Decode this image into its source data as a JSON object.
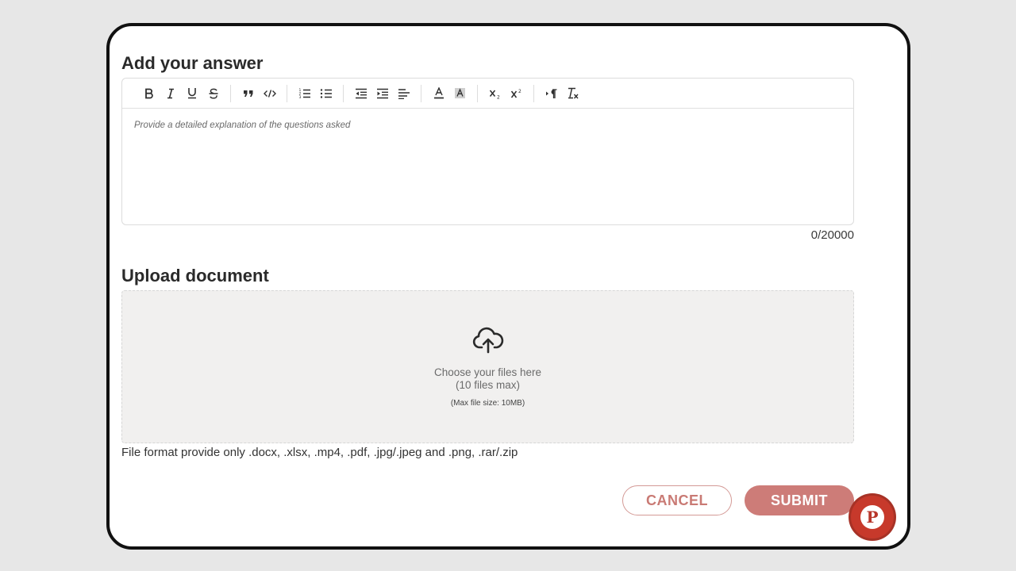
{
  "answer": {
    "title": "Add your answer",
    "placeholder": "Provide a detailed explanation of the questions asked",
    "char_count": "0/20000",
    "toolbar": {
      "groups": [
        [
          "bold-icon",
          "italic-icon",
          "underline-icon",
          "strikethrough-icon"
        ],
        [
          "blockquote-icon",
          "code-icon"
        ],
        [
          "ordered-list-icon",
          "bullet-list-icon"
        ],
        [
          "outdent-icon",
          "indent-icon",
          "align-left-icon"
        ],
        [
          "text-color-icon",
          "background-color-icon"
        ],
        [
          "subscript-icon",
          "superscript-icon"
        ],
        [
          "text-direction-icon",
          "clear-format-icon"
        ]
      ]
    }
  },
  "upload": {
    "title": "Upload document",
    "icon": "cloud-upload-icon",
    "line1": "Choose your files here",
    "line2": "(10 files max)",
    "max_size": "(Max file size: 10MB)",
    "format_note": "File format provide only .docx, .xlsx, .mp4, .pdf, .jpg/.jpeg and .png, .rar/.zip"
  },
  "actions": {
    "cancel_label": "CANCEL",
    "submit_label": "SUBMIT"
  },
  "fab": {
    "letter": "P",
    "icon": "brand-logo-icon"
  },
  "colors": {
    "accent": "#cd7c78",
    "cancel_border": "#d49a96",
    "fab": "#c7392b",
    "dropzone_bg": "#f1f0ef"
  }
}
